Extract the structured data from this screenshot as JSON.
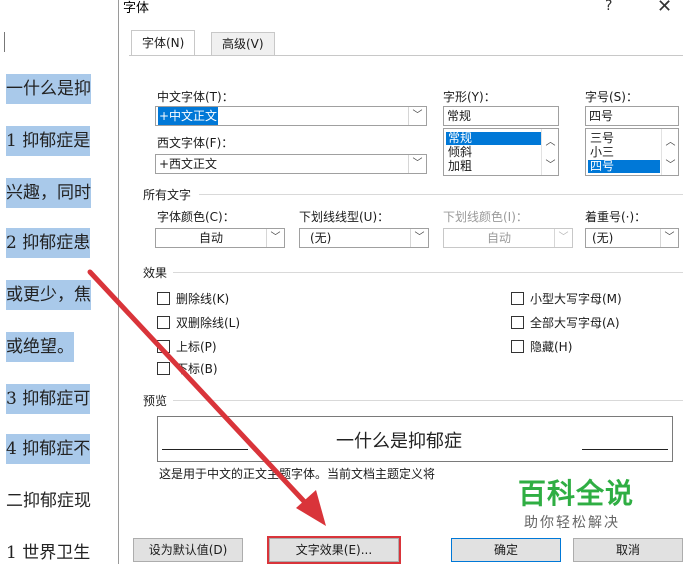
{
  "document": {
    "lines": [
      "一什么是抑",
      "1 抑郁症是",
      "兴趣，同时",
      "2 抑郁症患",
      "或更少，焦",
      "或绝望。",
      "3 抑郁症可",
      "4 抑郁症不",
      "二抑郁症现",
      "1 世界卫生"
    ]
  },
  "dialog": {
    "title": "字体",
    "help": "?",
    "close": "✕",
    "tabs": [
      "字体(N)",
      "高级(V)"
    ],
    "chinese_font": {
      "label": "中文字体(T)：",
      "value": "+中文正文"
    },
    "western_font": {
      "label": "西文字体(F)：",
      "value": "+西文正文"
    },
    "style": {
      "label": "字形(Y)：",
      "value": "常规",
      "options": [
        "常规",
        "倾斜",
        "加粗"
      ]
    },
    "size": {
      "label": "字号(S)：",
      "value": "四号",
      "options": [
        "三号",
        "小三",
        "四号"
      ]
    },
    "all_text": {
      "title": "所有文字",
      "font_color": {
        "label": "字体颜色(C)：",
        "value": "自动"
      },
      "underline_style": {
        "label": "下划线线型(U)：",
        "value": "(无)"
      },
      "underline_color": {
        "label": "下划线颜色(I)：",
        "value": "自动"
      },
      "emphasis": {
        "label": "着重号(·)：",
        "value": "(无)"
      }
    },
    "effects": {
      "title": "效果",
      "left": [
        "删除线(K)",
        "双删除线(L)",
        "上标(P)",
        "下标(B)"
      ],
      "right": [
        "小型大写字母(M)",
        "全部大写字母(A)",
        "隐藏(H)"
      ]
    },
    "preview": {
      "title": "预览",
      "text": "一什么是抑郁症",
      "description": "这是用于中文的正文主题字体。当前文档主题定义将"
    },
    "buttons": {
      "set_default": "设为默认值(D)",
      "text_effects": "文字效果(E)...",
      "ok": "确定",
      "cancel": "取消"
    }
  },
  "watermark": {
    "brand": "百科全说",
    "slogan": "助你轻松解决"
  },
  "colors": {
    "selection": "#0078d7",
    "doc_highlight": "#a9c9ea",
    "annotation": "#d9343a",
    "watermark": "#2fae43"
  }
}
